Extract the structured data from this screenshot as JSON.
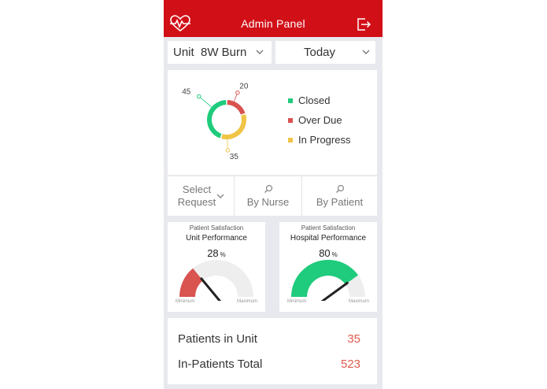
{
  "header": {
    "title": "Admin Panel",
    "logo_icon": "heart-pulse-icon",
    "logout_icon": "logout-icon",
    "color": "#d10f17"
  },
  "filters_top": {
    "unit_label": "Unit  8W Burn",
    "date_label": "Today"
  },
  "request_chart": {
    "legend": [
      {
        "label": "Closed",
        "color": "#1fcb7c"
      },
      {
        "label": "Over Due",
        "color": "#d9534f"
      },
      {
        "label": "In Progress",
        "color": "#f0c445"
      }
    ],
    "callouts": {
      "closed": "45",
      "overdue": "20",
      "inprogress": "35"
    }
  },
  "chart_data": {
    "type": "pie",
    "labels": [
      "Closed",
      "Over Due",
      "In Progress"
    ],
    "values": [
      45,
      20,
      35
    ],
    "colors": [
      "#1fcb7c",
      "#d9534f",
      "#f0c445"
    ]
  },
  "request_filters": [
    {
      "label": "Select Request",
      "icon": "chevron-down-icon"
    },
    {
      "label": "By Nurse",
      "icon": "search-icon"
    },
    {
      "label": "By Patient",
      "icon": "search-icon"
    }
  ],
  "gauges": [
    {
      "subtitle": "Patient Satisfaction",
      "title": "Unit Performance",
      "value": "28",
      "unit": "%",
      "fraction": 0.28,
      "color": "#d9534f",
      "min_label": "Minimum",
      "max_label": "Maximum"
    },
    {
      "subtitle": "Patient Satisfaction",
      "title": "Hospital Performance",
      "value": "80",
      "unit": "%",
      "fraction": 0.8,
      "color": "#1fcb7c",
      "min_label": "Minimum",
      "max_label": "Maximum"
    }
  ],
  "stats": [
    {
      "label": "Patients in Unit",
      "value": "35"
    },
    {
      "label": "In-Patients Total",
      "value": "523"
    }
  ]
}
